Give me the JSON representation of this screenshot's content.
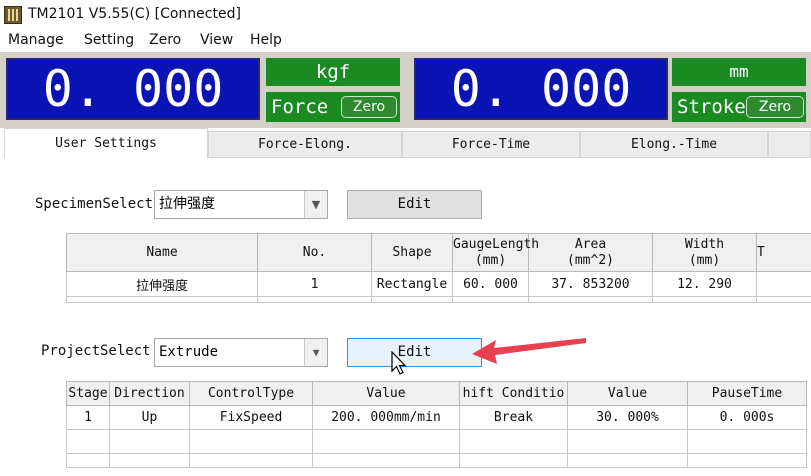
{
  "window": {
    "title": "TM2101 V5.55(C)   [Connected]"
  },
  "menu": [
    "Manage",
    "Setting",
    "Zero",
    "View",
    "Help"
  ],
  "force": {
    "value": "0. 000",
    "unit": "kgf",
    "label": "Force",
    "zero_label": "Zero"
  },
  "stroke": {
    "value": "0. 000",
    "unit": "mm",
    "label": "Stroke",
    "zero_label": "Zero"
  },
  "tabs": [
    "User Settings",
    "Force-Elong.",
    "Force-Time",
    "Elong.-Time"
  ],
  "specimen": {
    "label": "SpecimenSelect",
    "value": "拉伸强度",
    "edit_label": "Edit",
    "columns": [
      "Name",
      "No.",
      "Shape",
      "GaugeLength\n(mm)",
      "Area\n(mm^2)",
      "Width\n(mm)",
      "T"
    ],
    "rows": [
      [
        "拉伸强度",
        "1",
        "Rectangle",
        "60. 000",
        "37. 853200",
        "12. 290",
        ""
      ]
    ]
  },
  "project": {
    "label": "ProjectSelect",
    "value": "Extrude",
    "edit_label": "Edit",
    "columns": [
      "Stage",
      "Direction",
      "ControlType",
      "Value",
      "hift Conditio",
      "Value",
      "PauseTime"
    ],
    "rows": [
      [
        "1",
        "Up",
        "FixSpeed",
        "200. 000mm/min",
        "Break",
        "30. 000%",
        "0. 000s"
      ]
    ]
  },
  "colors": {
    "display_bg": "#0a14b4",
    "unit_bg": "#1b8a22",
    "annotation_arrow": "#e8404e"
  }
}
